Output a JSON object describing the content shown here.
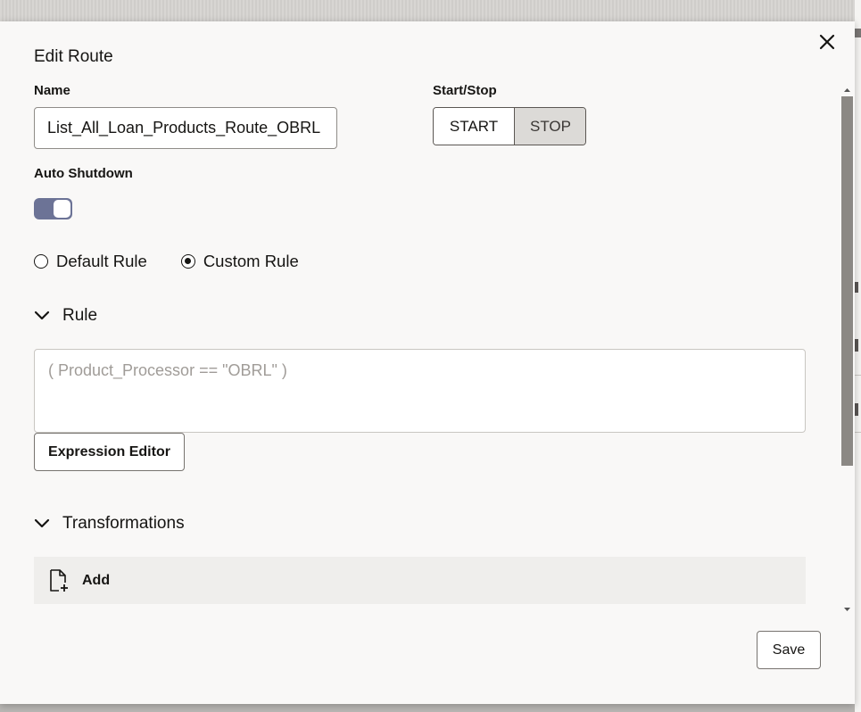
{
  "dialog": {
    "title": "Edit Route",
    "close_icon": "close-icon"
  },
  "name_field": {
    "label": "Name",
    "value": "List_All_Loan_Products_Route_OBRL"
  },
  "start_stop": {
    "label": "Start/Stop",
    "start_label": "START",
    "stop_label": "STOP",
    "selected": "START"
  },
  "auto_shutdown": {
    "label": "Auto Shutdown",
    "enabled": true
  },
  "rule_type": {
    "options": [
      "Default Rule",
      "Custom Rule"
    ],
    "selected": "Custom Rule"
  },
  "rule_section": {
    "title": "Rule",
    "expression": "( Product_Processor == \"OBRL\" )",
    "expression_editor_label": "Expression Editor"
  },
  "transformations_section": {
    "title": "Transformations",
    "add_label": "Add",
    "add_icon": "add-file-icon"
  },
  "footer": {
    "save_label": "Save"
  },
  "colors": {
    "toggle_on": "#6c7396",
    "text": "#161513"
  }
}
